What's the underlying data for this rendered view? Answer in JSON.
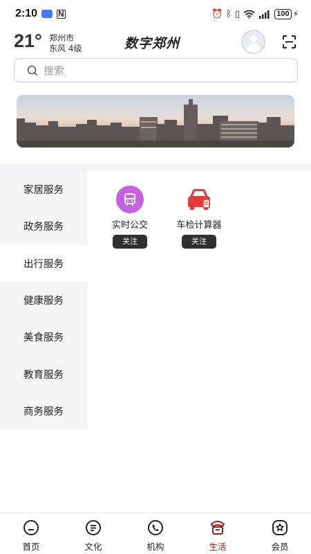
{
  "status_bar": {
    "time": "2:10",
    "nfc": "N",
    "battery": "100"
  },
  "header": {
    "temperature": "21°",
    "city": "郑州市",
    "wind": "东风  4级",
    "app_title": "数字郑州"
  },
  "search": {
    "placeholder": "搜索"
  },
  "categories": [
    {
      "label": "家居服务",
      "active": false
    },
    {
      "label": "政务服务",
      "active": false
    },
    {
      "label": "出行服务",
      "active": true
    },
    {
      "label": "健康服务",
      "active": false
    },
    {
      "label": "美食服务",
      "active": false
    },
    {
      "label": "教育服务",
      "active": false
    },
    {
      "label": "商务服务",
      "active": false
    }
  ],
  "services": [
    {
      "label": "实时公交",
      "follow_label": "关注",
      "icon": "bus-icon",
      "color": "#c661e0"
    },
    {
      "label": "车检计算器",
      "follow_label": "关注",
      "icon": "car-icon",
      "color": "#e63a3a"
    }
  ],
  "bottom_nav": [
    {
      "label": "首页",
      "icon": "home-icon",
      "active": false
    },
    {
      "label": "文化",
      "icon": "culture-icon",
      "active": false
    },
    {
      "label": "机构",
      "icon": "institution-icon",
      "active": false
    },
    {
      "label": "生活",
      "icon": "life-icon",
      "active": true
    },
    {
      "label": "会员",
      "icon": "member-icon",
      "active": false
    }
  ],
  "colors": {
    "accent": "#9e1b1b",
    "follow_button": "#2f2f2f"
  }
}
